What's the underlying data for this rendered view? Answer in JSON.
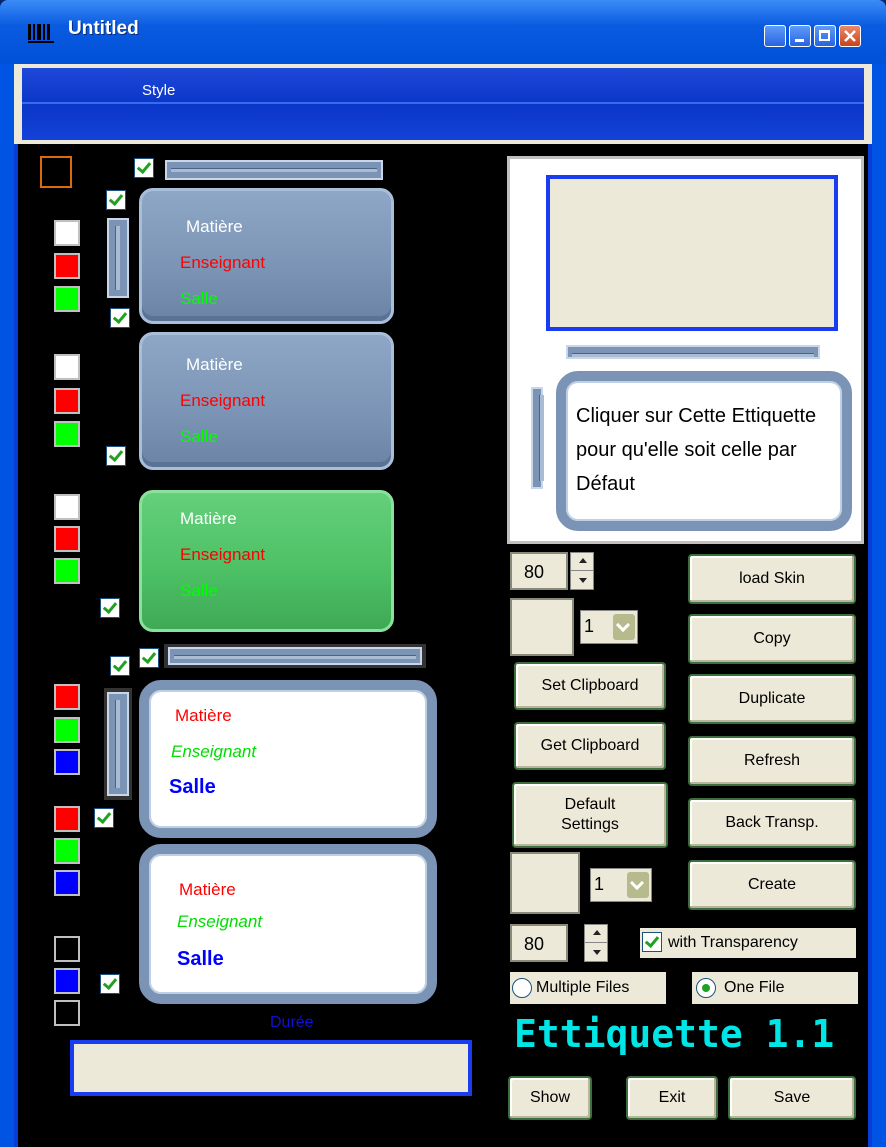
{
  "window": {
    "title": "Untitled"
  },
  "menu": {
    "style": "Style"
  },
  "cards": [
    {
      "line1": "Matière",
      "line2": "Enseignant",
      "line3": "Salle"
    },
    {
      "line1": "Matière",
      "line2": "Enseignant",
      "line3": "Salle"
    },
    {
      "line1": "Matière",
      "line2": "Enseignant",
      "line3": "Salle"
    },
    {
      "line1": "Matière",
      "line2": "Enseignant",
      "line3": "Salle"
    },
    {
      "line1": "Matière",
      "line2": "Enseignant",
      "line3": "Salle"
    }
  ],
  "duree_label": "Durée",
  "preview": {
    "text": "Cliquer sur Cette Ettiquette pour qu'elle soit celle par Défaut"
  },
  "spin1": {
    "value": "80"
  },
  "spin2": {
    "value": "80"
  },
  "combo1": {
    "value": "1"
  },
  "combo2": {
    "value": "1"
  },
  "buttons": {
    "load_skin": "load Skin",
    "copy": "Copy",
    "set_clipboard": "Set Clipboard",
    "duplicate": "Duplicate",
    "get_clipboard": "Get Clipboard",
    "refresh": "Refresh",
    "default_settings": "Default Settings",
    "back_transp": "Back Transp.",
    "create": "Create",
    "show": "Show",
    "exit": "Exit",
    "save": "Save"
  },
  "transparency": {
    "label": "with Transparency",
    "checked": true
  },
  "radio": {
    "multiple": "Multiple Files",
    "one": "One File",
    "selected": "One File"
  },
  "app_title": "Ettiquette 1.1",
  "colors": {
    "accent_title": "#00e5e5",
    "blue_card": "#7b94b5",
    "green_card": "#4cbf64"
  }
}
